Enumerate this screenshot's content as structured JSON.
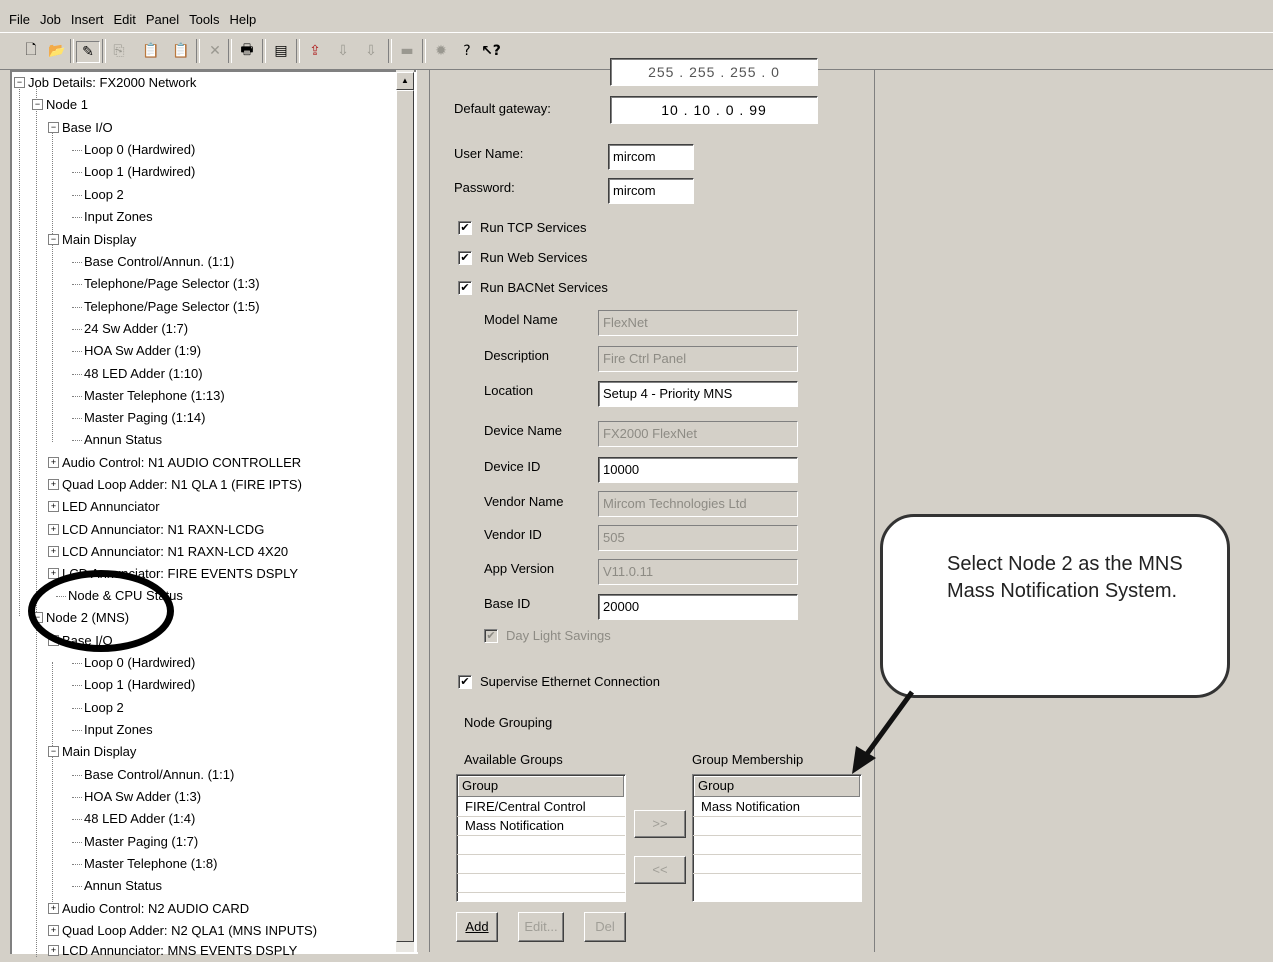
{
  "menu": [
    "File",
    "Job",
    "Insert",
    "Edit",
    "Panel",
    "Tools",
    "Help"
  ],
  "toolbar": [
    "new-icon",
    "open-icon",
    "edit-icon",
    "copy-icon",
    "paste-icon",
    "paste-special-icon",
    "delete-icon",
    "print-icon",
    "properties-icon",
    "upload-icon",
    "download-icon",
    "download-all-icon",
    "compile-icon",
    "settings-icon",
    "help-icon",
    "context-help-icon"
  ],
  "tree": {
    "root": "Job Details: FX2000 Network",
    "node1": "Node 1",
    "base_io": "Base I/O",
    "n1_loop0": "Loop 0  (Hardwired)",
    "n1_loop1": "Loop 1  (Hardwired)",
    "n1_loop2": "Loop 2",
    "n1_input": "Input Zones",
    "n1_main": "Main Display",
    "n1_md": [
      "Base Control/Annun. (1:1)",
      "Telephone/Page Selector (1:3)",
      "Telephone/Page Selector (1:5)",
      "24 Sw Adder (1:7)",
      "HOA Sw Adder (1:9)",
      "48 LED Adder (1:10)",
      "Master Telephone (1:13)",
      "Master Paging (1:14)",
      "Annun Status"
    ],
    "n1_audio": "Audio Control: N1 AUDIO CONTROLLER",
    "n1_quad": "Quad Loop Adder: N1 QLA 1 (FIRE IPTS)",
    "n1_led": "LED Annunciator",
    "n1_lcd1": "LCD Annunciator: N1 RAXN-LCDG",
    "n1_lcd2": "LCD Annunciator: N1 RAXN-LCD 4X20",
    "n1_lcd3": "LCD Annunciator: FIRE EVENTS DSPLY",
    "n1_cpu": "Node & CPU Status",
    "node2": "Node 2 (MNS)",
    "n2_base": "Base I/O",
    "n2_loop0": "Loop 0  (Hardwired)",
    "n2_loop1": "Loop 1  (Hardwired)",
    "n2_loop2": "Loop 2",
    "n2_input": "Input Zones",
    "n2_main": "Main Display",
    "n2_md": [
      "Base Control/Annun. (1:1)",
      "HOA Sw Adder (1:3)",
      "48 LED Adder (1:4)",
      "Master Paging (1:7)",
      "Master Telephone (1:8)",
      "Annun Status"
    ],
    "n2_audio": "Audio Control: N2 AUDIO CARD",
    "n2_quad": "Quad Loop Adder: N2 QLA1 (MNS INPUTS)",
    "n2_lcd": "LCD Annunciator: MNS EVENTS DSPLY"
  },
  "props": {
    "subnet_partial": "255 . 255 . 255 . 0",
    "gateway_label": "Default gateway:",
    "gateway": [
      "10",
      "10",
      "0",
      "99"
    ],
    "user_label": "User Name:",
    "user": "mircom",
    "pass_label": "Password:",
    "pass": "mircom",
    "tcp": "Run TCP Services",
    "web": "Run Web Services",
    "bacnet": "Run BACNet Services",
    "model_label": "Model Name",
    "model": "FlexNet",
    "desc_label": "Description",
    "desc": "Fire Ctrl Panel",
    "loc_label": "Location",
    "loc": "Setup 4 - Priority MNS",
    "devname_label": "Device Name",
    "devname": "FX2000 FlexNet",
    "devid_label": "Device ID",
    "devid": "10000",
    "vendor_label": "Vendor Name",
    "vendor": "Mircom Technologies Ltd",
    "vendorid_label": "Vendor ID",
    "vendorid": "505",
    "appver_label": "App Version",
    "appver": "V11.0.11",
    "baseid_label": "Base ID",
    "baseid": "20000",
    "dls": "Day Light Savings",
    "supervise": "Supervise Ethernet Connection",
    "grouping": "Node Grouping",
    "available": "Available Groups",
    "membership": "Group Membership",
    "group_hdr": "Group",
    "available_items": [
      "FIRE/Central Control",
      "Mass Notification"
    ],
    "member_items": [
      "Mass Notification"
    ],
    "move_right": ">>",
    "move_left": "<<",
    "add": "Add",
    "edit": "Edit...",
    "del": "Del"
  },
  "callout": "Select Node 2 as the MNS Mass Notification System."
}
